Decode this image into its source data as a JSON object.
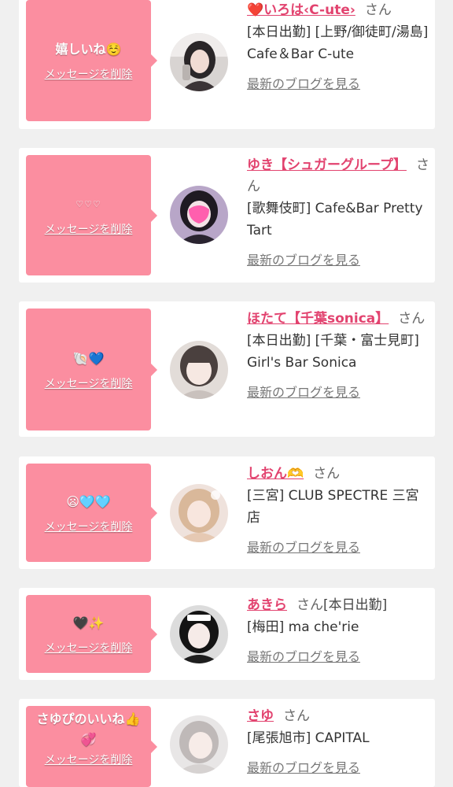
{
  "entries": [
    {
      "message": "嬉しいね☺️",
      "delete_label": "メッセージを削除",
      "name": "❤️いろは‹C-ute›",
      "san": "さん",
      "shop": "[本日出勤] [上野/御徒町/湯島] Cafe＆Bar C-ute",
      "blog_label": "最新のブログを見る"
    },
    {
      "message": "♡♡♡",
      "delete_label": "メッセージを削除",
      "name": "ゆき【シュガーグループ】",
      "san": "さん",
      "shop": "[歌舞伎町] Cafe&Bar Pretty Tart",
      "blog_label": "最新のブログを見る"
    },
    {
      "message": "🐚💙",
      "delete_label": "メッセージを削除",
      "name": "ほたて【千葉sonica】",
      "san": "さん",
      "shop": "[本日出勤] [千葉・富士見町] Girl's Bar Sonica",
      "blog_label": "最新のブログを見る"
    },
    {
      "message": "😦🩵🩵",
      "delete_label": "メッセージを削除",
      "name": "しおん🫶",
      "san": "さん",
      "shop": "[三宮] CLUB SPECTRE 三宮店",
      "blog_label": "最新のブログを見る"
    },
    {
      "message": "🖤✨",
      "delete_label": "メッセージを削除",
      "name": "あきら",
      "san": "さん",
      "note": "[本日出勤]",
      "shop": "[梅田] ma che'rie",
      "blog_label": "最新のブログを見る"
    },
    {
      "message": "さゆぴのいいね👍💞",
      "delete_label": "メッセージを削除",
      "name": "さゆ",
      "san": "さん",
      "shop": "[尾張旭市] CAPITAL",
      "blog_label": "最新のブログを見る"
    }
  ],
  "colors": {
    "bubble": "#fb8ea0",
    "name": "#e2436f"
  }
}
